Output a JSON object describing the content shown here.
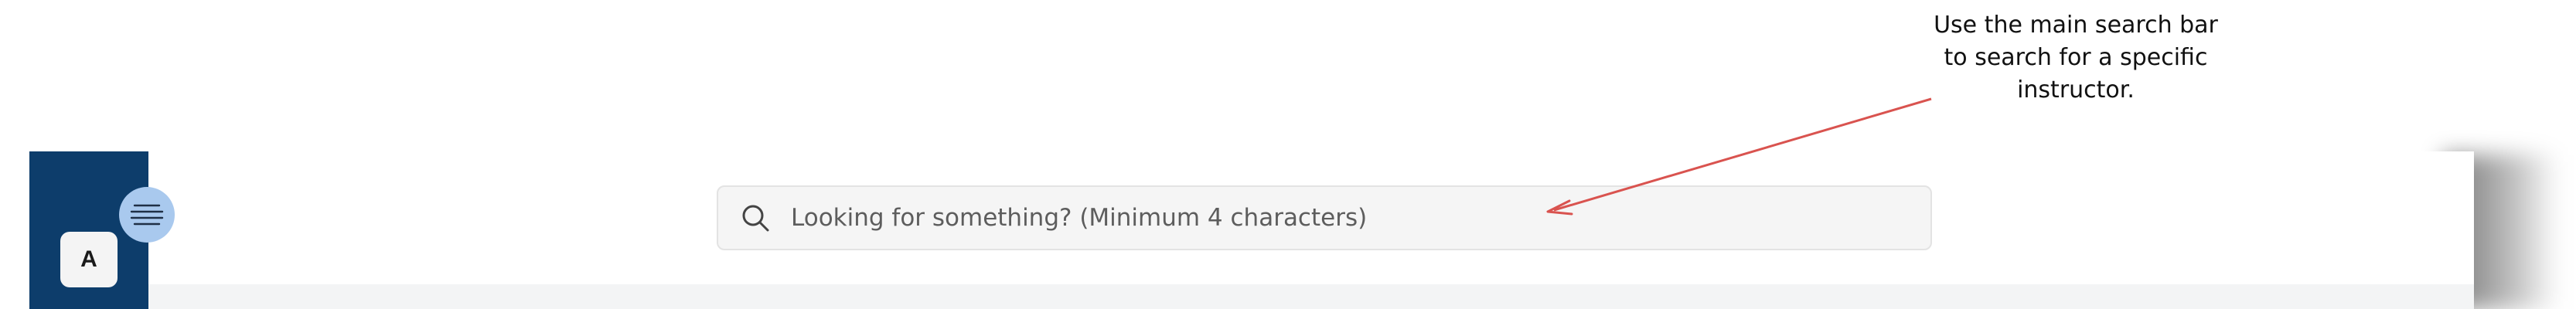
{
  "sidebar": {
    "avatar_letter": "A",
    "menu_icon": "hamburger-menu-icon"
  },
  "search": {
    "placeholder": "Looking for something? (Minimum 4 characters)",
    "icon": "search-icon"
  },
  "annotation": {
    "text": "Use the main search bar to search for a specific instructor.",
    "arrow_color": "#d9534f"
  },
  "colors": {
    "sidebar": "#0d3d6b",
    "menu_toggle": "#a9c9ee",
    "search_bg": "#f5f5f5"
  }
}
